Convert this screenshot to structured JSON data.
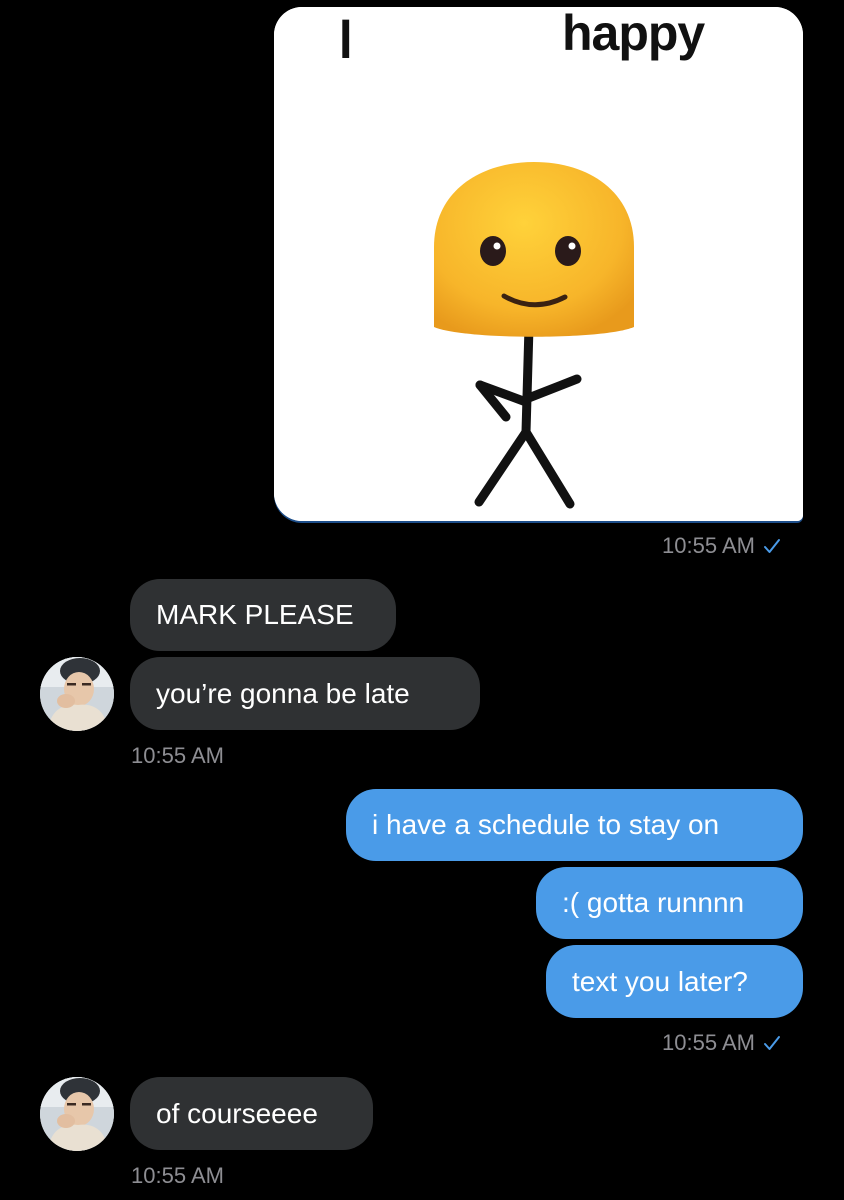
{
  "image_message": {
    "caption_words": [
      "I",
      "happy"
    ],
    "timestamp": "10:55 AM",
    "read_check": "checkmark-icon"
  },
  "incoming_group_1": {
    "messages": [
      "MARK PLEASE",
      "you’re gonna be late"
    ],
    "timestamp": "10:55 AM",
    "avatar": "avatar-photo"
  },
  "outgoing_group": {
    "messages": [
      "i have a schedule to stay on",
      ":( gotta runnnn",
      "text you later?"
    ],
    "timestamp": "10:55 AM",
    "read_check": "checkmark-icon"
  },
  "incoming_group_2": {
    "messages": [
      "of courseeee"
    ],
    "timestamp": "10:55 AM",
    "avatar": "avatar-photo"
  },
  "colors": {
    "background": "#000000",
    "incoming_bubble": "#2f3133",
    "outgoing_bubble": "#4a9be8",
    "timestamp": "#8e8e93",
    "check": "#4a9be8"
  }
}
